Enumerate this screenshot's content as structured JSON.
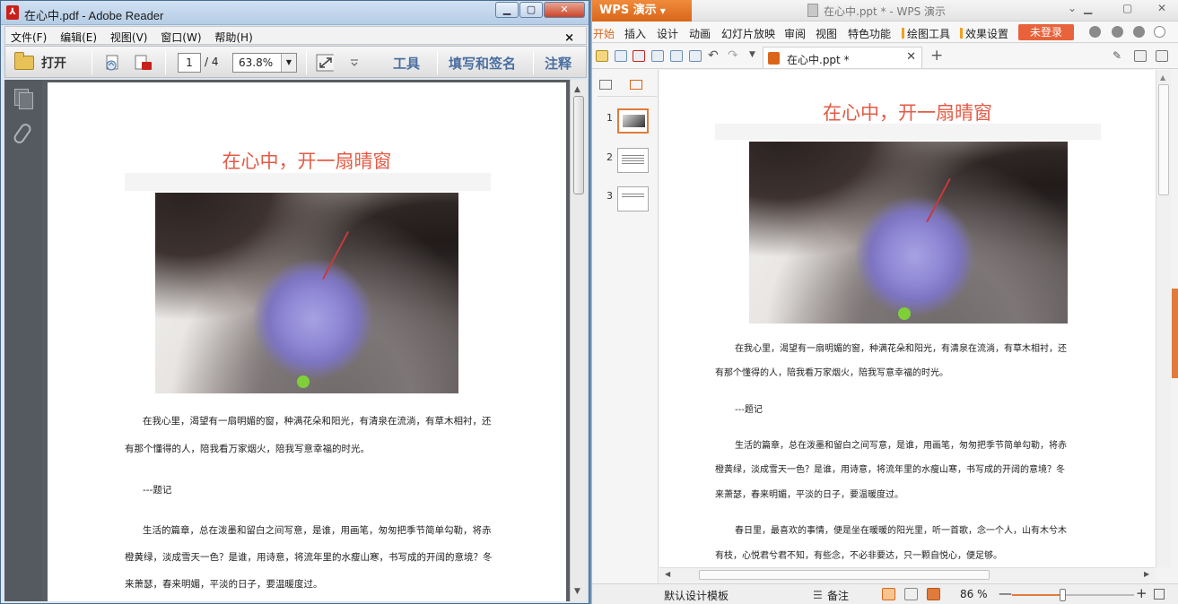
{
  "adobe": {
    "window_title": "在心中.pdf - Adobe Reader",
    "menu": [
      "文件(F)",
      "编辑(E)",
      "视图(V)",
      "窗口(W)",
      "帮助(H)"
    ],
    "menu_close": "×",
    "toolbar": {
      "open_label": "打开",
      "page_current": "1",
      "page_total": "/ 4",
      "zoom": "63.8%",
      "tools_label": "工具",
      "fill_sign_label": "填写和签名",
      "comment_label": "注释"
    },
    "doc": {
      "title": "在心中，开一扇晴窗",
      "para1_line1": "在我心里，渴望有一扇明媚的窗，种满花朵和阳光，有清泉在流淌，有草木相衬，还",
      "para1_line2": "有那个懂得的人，陪我看万家烟火，陪我写意幸福的时光。",
      "para2": "---题记",
      "para3_line1": "生活的篇章，总在泼墨和留白之间写意，是谁，用画笔，匆匆把季节简单勾勒，将赤",
      "para3_line2": "橙黄绿，淡成雪天一色？是谁，用诗意，将流年里的水瘦山寒，书写成的开阔的意境？冬",
      "para3_line3": "来萧瑟，春来明媚，平淡的日子，要温暖度过。"
    }
  },
  "wps": {
    "brand": "WPS 演示",
    "window_title": "在心中.ppt * - WPS 演示",
    "menu": [
      "开始",
      "插入",
      "设计",
      "动画",
      "幻灯片放映",
      "审阅",
      "视图",
      "特色功能",
      "绘图工具",
      "效果设置"
    ],
    "login_label": "未登录",
    "doc_tab": "在心中.ppt *",
    "slides": [
      "1",
      "2",
      "3"
    ],
    "slide": {
      "title": "在心中，开一扇晴窗",
      "para1_line1": "在我心里，渴望有一扇明媚的窗，种满花朵和阳光，有清泉在流淌，有草木相衬，还",
      "para1_line2": "有那个懂得的人，陪我看万家烟火，陪我写意幸福的时光。",
      "para2": "---题记",
      "para3_line1": "生活的篇章，总在泼墨和留白之间写意，是谁，用画笔，匆匆把季节简单勾勒，将赤",
      "para3_line2": "橙黄绿，淡成雪天一色？是谁，用诗意，将流年里的水瘦山寒，书写成的开阔的意境？冬",
      "para3_line3": "来萧瑟，春来明媚，平淡的日子，要温暖度过。",
      "para4_line1": "春日里，最喜欢的事情，便是坐在暖暖的阳光里，听一首歌，念一个人，山有木兮木",
      "para4_line2": "有枝，心悦君兮君不知，有些念，不必非要达，只一颗自悦心，便足够。"
    },
    "status": {
      "template": "默认设计模板",
      "notes": "备注",
      "zoom": "86 %",
      "zoom_minus": "—",
      "zoom_plus": "+",
      "zoom_fraction": 0.42
    }
  },
  "colors": {
    "title_red": "#e35b46",
    "wps_orange": "#d9661a"
  }
}
